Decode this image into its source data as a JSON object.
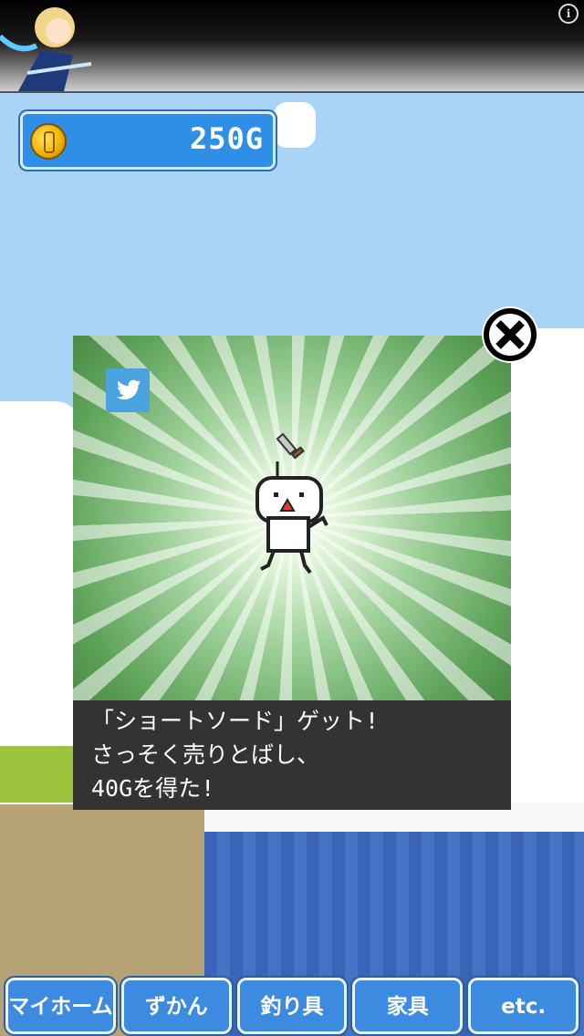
{
  "hud": {
    "gold": "250G"
  },
  "ad_banner": {
    "info_icon": "i"
  },
  "modal": {
    "share_icon": "twitter-icon",
    "close_icon": "close-x-icon",
    "caption_lines": [
      "「ショートソード」ゲット!",
      "さっそく売りとばし、",
      "40Gを得た!"
    ]
  },
  "nav": {
    "buttons": [
      {
        "label": "マイホーム"
      },
      {
        "label": "ずかん"
      },
      {
        "label": "釣り具"
      },
      {
        "label": "家具"
      },
      {
        "label": "etc."
      }
    ]
  },
  "colors": {
    "sky": "#a9d4f5",
    "panel_blue": "#2f8fe6",
    "caption_bg": "#333333",
    "twitter_blue": "#4aa3df"
  }
}
